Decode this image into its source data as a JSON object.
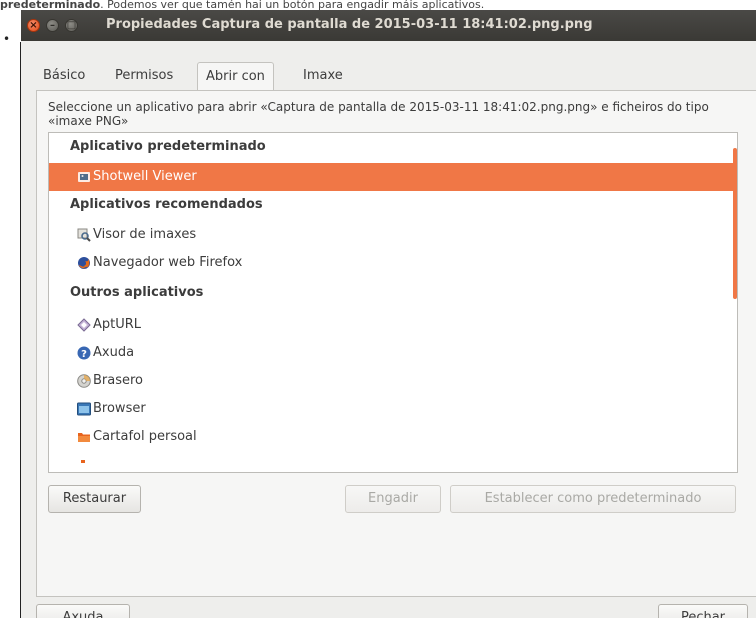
{
  "page": {
    "caption_prefix": "predeterminado",
    "caption_rest": ". Podemos ver que tamén hai un botón para engadir máis aplicativos.",
    "bullet": "•"
  },
  "window": {
    "title": "Propiedades Captura de pantalla de 2015-03-11 18:41:02.png.png",
    "close_glyph": "×",
    "minimize_glyph": "–",
    "maximize_glyph": "□"
  },
  "tabs": [
    {
      "label": "Básico"
    },
    {
      "label": "Permisos"
    },
    {
      "label": "Abrir con"
    },
    {
      "label": "Imaxe"
    }
  ],
  "instruction": "Seleccione un aplicativo para abrir «Captura de pantalla de 2015-03-11 18:41:02.png.png» e ficheiros do tipo «imaxe PNG»",
  "sections": {
    "default": "Aplicativo predeterminado",
    "recommended": "Aplicativos recomendados",
    "other": "Outros aplicativos"
  },
  "apps": {
    "default": [
      {
        "label": "Shotwell Viewer",
        "icon": "shotwell-icon"
      }
    ],
    "recommended": [
      {
        "label": "Visor de imaxes",
        "icon": "image-viewer-icon"
      },
      {
        "label": "Navegador web Firefox",
        "icon": "firefox-icon"
      }
    ],
    "other": [
      {
        "label": "AptURL",
        "icon": "apturl-icon"
      },
      {
        "label": "Axuda",
        "icon": "help-icon"
      },
      {
        "label": "Brasero",
        "icon": "brasero-icon"
      },
      {
        "label": "Browser",
        "icon": "browser-icon"
      },
      {
        "label": "Cartafol persoal",
        "icon": "folder-icon"
      }
    ]
  },
  "buttons": {
    "reset": "Restaurar",
    "add": "Engadir",
    "set_default": "Establecer como predeterminado",
    "help": "Axuda",
    "close": "Pechar"
  },
  "colors": {
    "selection": "#f07746",
    "titlebar": "#3c3b37",
    "window_bg": "#eeeeec"
  }
}
